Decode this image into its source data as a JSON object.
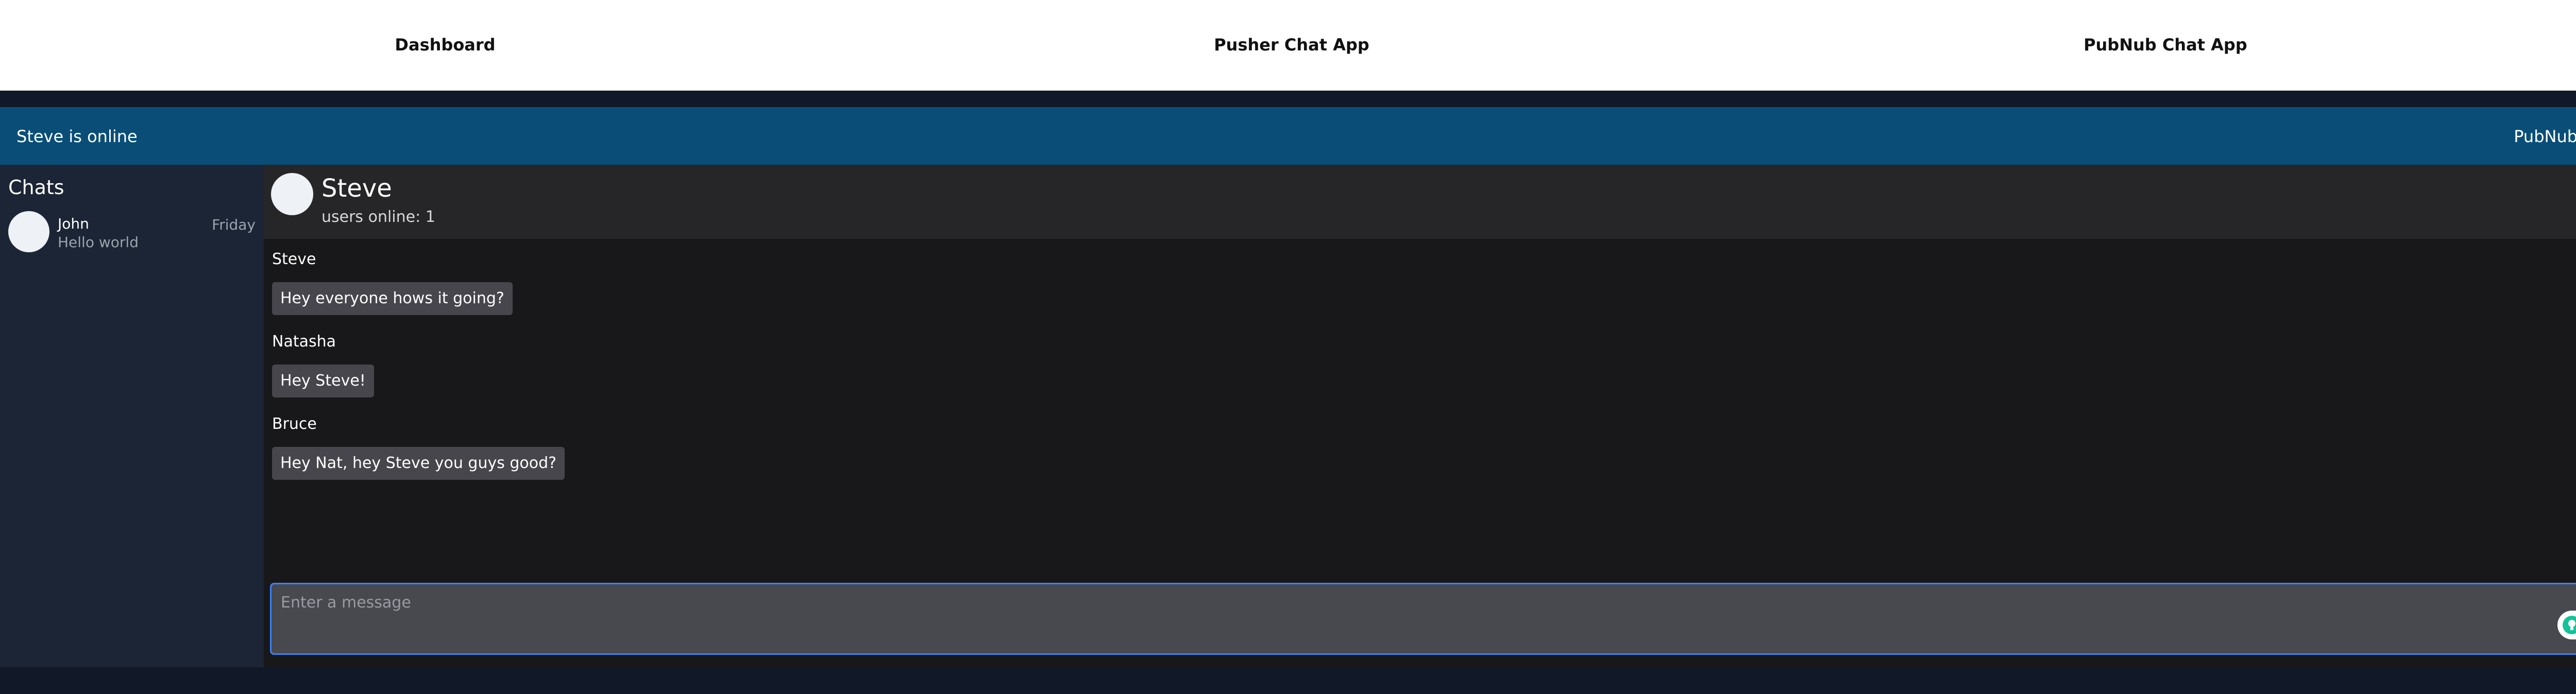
{
  "nav": {
    "links": [
      "Dashboard",
      "Pusher Chat App",
      "PubNub Chat App"
    ]
  },
  "statusbar": {
    "presence": "Steve is online",
    "app_name": "PubNub Chat"
  },
  "sidebar": {
    "heading": "Chats",
    "conversations": [
      {
        "name": "John",
        "preview": "Hello world",
        "date": "Friday"
      }
    ]
  },
  "chat": {
    "title": "Steve",
    "users_online": "users online: 1",
    "messages": [
      {
        "sender": "Steve",
        "text": "Hey everyone hows it going?"
      },
      {
        "sender": "Natasha",
        "text": "Hey Steve!"
      },
      {
        "sender": "Bruce",
        "text": "Hey Nat, hey Steve you guys good?"
      }
    ]
  },
  "composer": {
    "placeholder": "Enter a message"
  },
  "icons": {
    "extension_1": "lightbulb-icon",
    "extension_2": "grammarly-icon"
  },
  "colors": {
    "nav_bg": "#ffffff",
    "statusbar_bg": "#0a4e78",
    "sidebar_bg": "#1c2535",
    "chat_header_bg": "#262628",
    "messages_bg": "#18181b",
    "bubble_bg": "#46464c",
    "input_border": "#3b82f6",
    "extension_green": "#15c39a"
  }
}
